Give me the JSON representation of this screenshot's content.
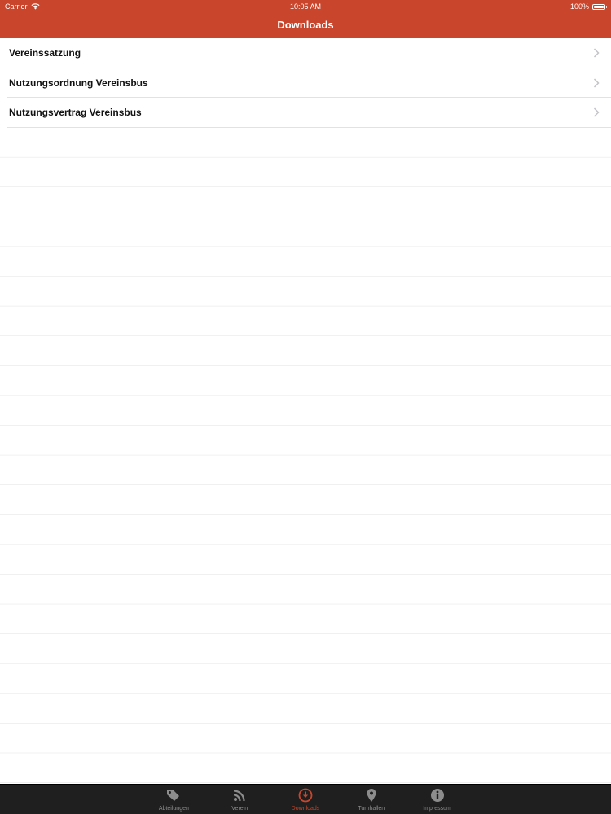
{
  "status_bar": {
    "carrier": "Carrier",
    "time": "10:05 AM",
    "battery": "100%",
    "battery_level": 1.0
  },
  "nav_bar": {
    "title": "Downloads"
  },
  "downloads": {
    "items": [
      {
        "label": "Vereinssatzung"
      },
      {
        "label": "Nutzungsordnung Vereinsbus"
      },
      {
        "label": "Nutzungsvertrag Vereinsbus"
      }
    ]
  },
  "tab_bar": {
    "active": "Downloads",
    "tabs": [
      {
        "label": "Abteilungen",
        "icon": "tag-icon"
      },
      {
        "label": "Verein",
        "icon": "rss-icon"
      },
      {
        "label": "Downloads",
        "icon": "download-icon"
      },
      {
        "label": "Turnhallen",
        "icon": "map-pin-icon"
      },
      {
        "label": "Impressum",
        "icon": "info-icon"
      }
    ]
  },
  "colors": {
    "accent": "#c9462c",
    "tab_bar_bg": "#1f1f1f",
    "tab_inactive": "#8c8c8c"
  }
}
